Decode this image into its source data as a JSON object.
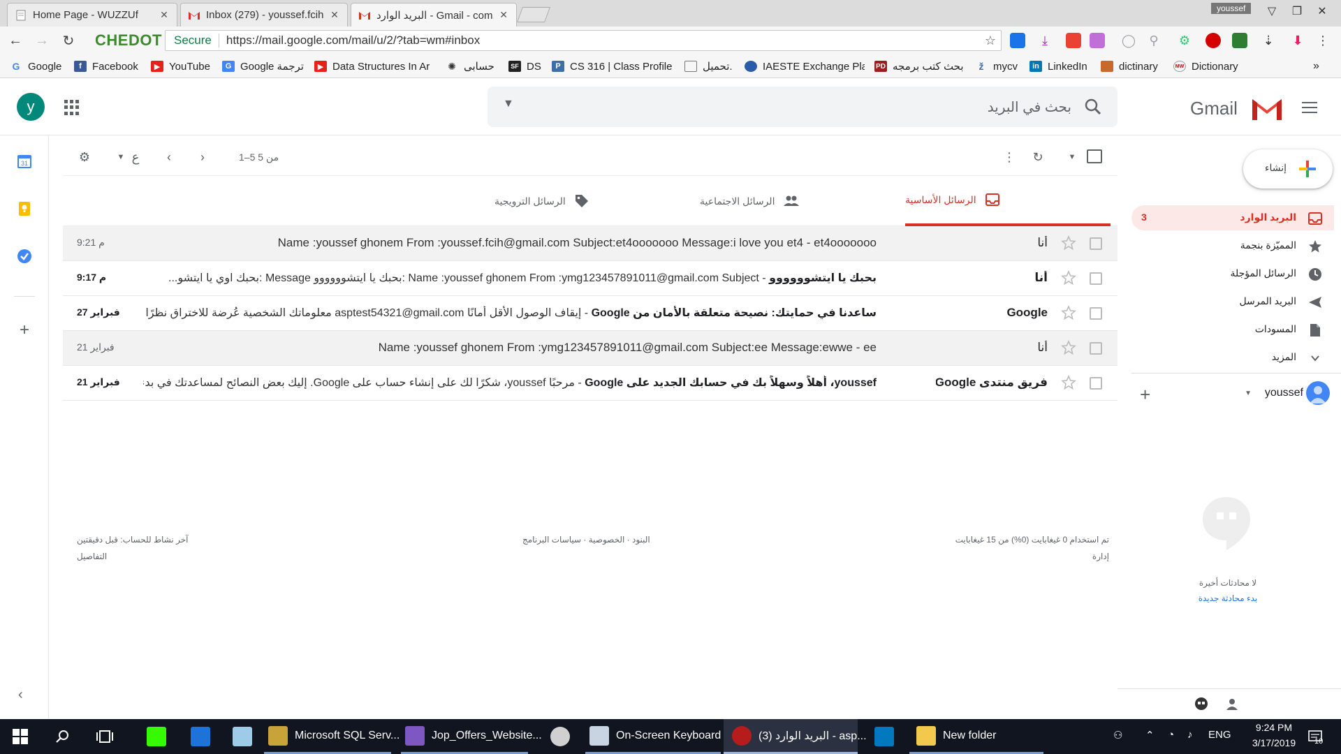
{
  "browser": {
    "tabs": [
      {
        "title": "Home Page - WUZZUf",
        "icon": "document-icon"
      },
      {
        "title": "Inbox (279) - youssef.fcih",
        "icon": "gmail-icon"
      },
      {
        "title": "البريد الوارد - Gmail - com.",
        "icon": "gmail-icon"
      }
    ],
    "profile": "youssef",
    "brand": "CHEDOT",
    "secure_label": "Secure",
    "url": "https://mail.google.com/mail/u/2/?tab=wm#inbox",
    "bookmarks": [
      "Google",
      "Facebook",
      "YouTube",
      "Google ترجمة",
      "Data Structures In Ar",
      "حسابى",
      "DS",
      "CS 316 | Class Profile",
      "تحميل.",
      "IAESTE Exchange Plat",
      "بحث كتب برمجه",
      "mycv",
      "LinkedIn",
      "dictinary",
      "Dictionary"
    ],
    "colors": {
      "brand": "#3d8a2e",
      "secure": "#0b8043"
    }
  },
  "gmail": {
    "avatar_letter": "y",
    "search_placeholder": "بحث في البريد",
    "logo_text": "Gmail",
    "toolbar": {
      "input_lang": "ع",
      "pagination": "1–5 من 5"
    },
    "categories": [
      {
        "label": "الرسائل الأساسية",
        "active": true
      },
      {
        "label": "الرسائل الاجتماعية",
        "active": false
      },
      {
        "label": "الرسائل الترويجية",
        "active": false
      }
    ],
    "emails": [
      {
        "sender": "أنا",
        "subject": "",
        "snippet": "Name :youssef ghonem From :youssef.fcih@gmail.com Subject:et4ooooooo Message:i love you et4 - et4ooooooo",
        "date": "9:21 م",
        "unread": false
      },
      {
        "sender": "أنا",
        "subject": "بحبك يا ايتشوووووو",
        "snippet": " - Name :youssef ghonem From :ymg123457891011@gmail.com Subject :بحبك يا ايتشوووووو Message :بحبك اوي يا ايتشو...",
        "date": "9:17 م",
        "unread": true
      },
      {
        "sender": "Google",
        "subject": "ساعدنا في حمايتك: نصيحة متعلقة بالأمان من Google",
        "snippet": " - إيقاف الوصول الأقل أمانًا asptest54321@gmail.com معلوماتك الشخصية عُرضة للاختراق نظرًا لأنك تسمح...",
        "date": "27 فبراير",
        "unread": true
      },
      {
        "sender": "أنا",
        "subject": "",
        "snippet": "Name :youssef ghonem From :ymg123457891011@gmail.com Subject:ee Message:ewwe - ee",
        "date": "21 فبراير",
        "unread": false
      },
      {
        "sender": "فريق منتدى Google",
        "subject": "youssef، أهلاً وسهلاً بك في حسابك الجديد على Google",
        "snippet": " - مرحبًا youssef، شكرًا لك على إنشاء حساب على Google. إليك بعض النصائح لمساعدتك في بدء استخدام هذا ...",
        "date": "21 فبراير",
        "unread": true
      }
    ],
    "footer": {
      "storage": "تم استخدام 0 غيغابايت (0%) من 15 غيغابايت",
      "manage": "إدارة",
      "terms": "البنود · الخصوصية · سياسات البرنامج",
      "activity": "آخر نشاط للحساب: قبل دقيقتين",
      "details": "التفاصيل"
    },
    "sidebar": {
      "compose": "إنشاء",
      "nav": [
        {
          "label": "البريد الوارد",
          "count": "3",
          "icon": "inbox-icon",
          "active": true
        },
        {
          "label": "المميّزة بنجمة",
          "count": "",
          "icon": "star-icon",
          "active": false
        },
        {
          "label": "الرسائل المؤجلة",
          "count": "",
          "icon": "clock-icon",
          "active": false
        },
        {
          "label": "البريد المرسل",
          "count": "",
          "icon": "send-icon",
          "active": false
        },
        {
          "label": "المسودات",
          "count": "",
          "icon": "draft-icon",
          "active": false
        },
        {
          "label": "المزيد",
          "count": "",
          "icon": "chevron-down-icon",
          "active": false
        }
      ],
      "hangouts_user": "youssef",
      "no_chats": "لا محادثات أخيرة",
      "new_chat": "بدء محادثة جديدة"
    },
    "colors": {
      "accent": "#d93025",
      "active_bg": "#fce8e6",
      "link": "#1a73e8"
    }
  },
  "taskbar": {
    "items": [
      {
        "label": "",
        "icon": "dreamweaver-icon"
      },
      {
        "label": "",
        "icon": "snipping-tool-icon"
      },
      {
        "label": "",
        "icon": "notepad-icon"
      },
      {
        "label": "Microsoft SQL Serv...",
        "icon": "sql-server-icon"
      },
      {
        "label": "Jop_Offers_Website...",
        "icon": "visual-studio-icon"
      },
      {
        "label": "",
        "icon": "paint-icon"
      },
      {
        "label": "On-Screen Keyboard",
        "icon": "keyboard-icon"
      },
      {
        "label": "البريد الوارد (3) - asp...",
        "icon": "chedot-icon"
      },
      {
        "label": "",
        "icon": "trello-icon"
      },
      {
        "label": "New folder",
        "icon": "folder-icon"
      }
    ],
    "lang": "ENG",
    "time": "9:24 PM",
    "date": "3/17/2019",
    "notifications": "10"
  }
}
